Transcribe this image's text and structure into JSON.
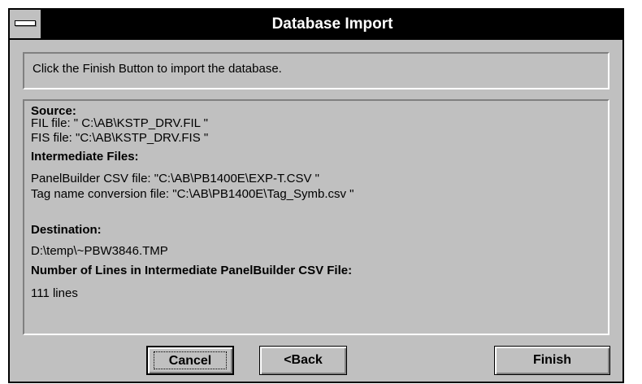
{
  "window": {
    "title": "Database Import"
  },
  "instruction": "Click the Finish Button to import the database.",
  "info": {
    "source_heading": "Source:",
    "fil_file": "FIL file: \" C:\\AB\\KSTP_DRV.FIL \"",
    "fis_file": "FIS file: \"C:\\AB\\KSTP_DRV.FIS \"",
    "intermediate_heading": "Intermediate Files:",
    "csv_file": "PanelBuilder CSV file: \"C:\\AB\\PB1400E\\EXP-T.CSV \"",
    "tag_file": "Tag name conversion file: \"C:\\AB\\PB1400E\\Tag_Symb.csv \"",
    "destination_heading": "Destination:",
    "destination_path": "D:\\temp\\~PBW3846.TMP",
    "lines_heading": "Number of Lines in Intermediate PanelBuilder CSV File:",
    "lines_value": "111 lines"
  },
  "buttons": {
    "cancel": "Cancel",
    "back": "<Back",
    "finish": "Finish"
  }
}
